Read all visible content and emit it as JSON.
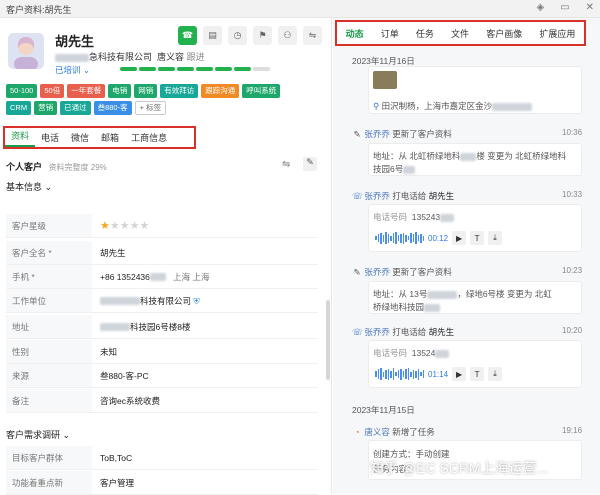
{
  "window": {
    "title": "客户资料:胡先生",
    "icons": [
      "◈",
      "▭",
      "✕"
    ]
  },
  "toolbar": {
    "icons": [
      "☎",
      "▤",
      "◷",
      "⚑",
      "⚇",
      "⇋"
    ]
  },
  "customer": {
    "name": "胡先生",
    "company_suffix": "急科技有限公司",
    "owner": "唐义容",
    "follow": "跟进",
    "trained": "已培训 ⌄"
  },
  "tags": [
    "50-100",
    "50倍",
    "一年套餐",
    "电销",
    "网销",
    "有效拜访",
    "跟踪沟通",
    "呼叫系统",
    "CRM",
    "营销",
    "已通过",
    "叁880-客",
    "+ 标签"
  ],
  "tabs": [
    "资料",
    "电话",
    "微信",
    "邮箱",
    "工商信息"
  ],
  "profile": {
    "title": "个人客户",
    "completeness": "资料完整度 29%",
    "basic": "基本信息 ⌄"
  },
  "fields": [
    {
      "label": "客户星级",
      "value": ""
    },
    {
      "label": "客户全名 *",
      "value": "胡先生"
    },
    {
      "label": "手机 *",
      "value": "+86 1352436",
      "extra": "上海 上海"
    },
    {
      "label": "工作单位",
      "value": "科技有限公司"
    },
    {
      "label": "地址",
      "value": "科技园6号楼8楼"
    },
    {
      "label": "性别",
      "value": "未知"
    },
    {
      "label": "来源",
      "value": "叁880-客-PC"
    },
    {
      "label": "备注",
      "value": "咨询ec系统收费"
    }
  ],
  "survey": {
    "title": "客户需求调研 ⌄",
    "fields": [
      {
        "label": "目标客户群体",
        "value": "ToB,ToC"
      },
      {
        "label": "功能着重点新",
        "value": "客户管理"
      }
    ]
  },
  "rtabs": [
    "动态",
    "订单",
    "任务",
    "文件",
    "客户画像",
    "扩展应用"
  ],
  "timeline": {
    "date1": "2023年11月16日",
    "loc": "田沢制杨，上海市嘉定区金沙",
    "e1": {
      "who": "张乔乔",
      "action": "更新了客户资料",
      "time": "10:36",
      "detail": "地址：从 北虹桥绿地科",
      "detail2": "楼 变更为 北虹桥绿地科",
      "detail3": "技园6号"
    },
    "e2": {
      "who": "张乔乔",
      "action": "打电话给",
      "target": "胡先生",
      "time": "10:33",
      "phone_label": "电话号码",
      "phone": "135243",
      "dur": "00:12"
    },
    "e3": {
      "who": "张乔乔",
      "action": "更新了客户资料",
      "time": "10:23",
      "detail": "地址：从 13号",
      "detail2": "，绿地6号楼 变更为 北虹",
      "detail3": "桥绿地科技园"
    },
    "e4": {
      "who": "张乔乔",
      "action": "打电话给",
      "target": "胡先生",
      "time": "10:20",
      "phone_label": "电话号码",
      "phone": "13524",
      "dur": "01:14"
    },
    "date2": "2023年11月15日",
    "e5": {
      "who": "唐义容",
      "action": "新增了任务",
      "time": "19:16",
      "detail": "创建方式：手动创建",
      "detail2": "任务内容："
    }
  },
  "watermark": "知乎 @EC SCRM上海运营..."
}
